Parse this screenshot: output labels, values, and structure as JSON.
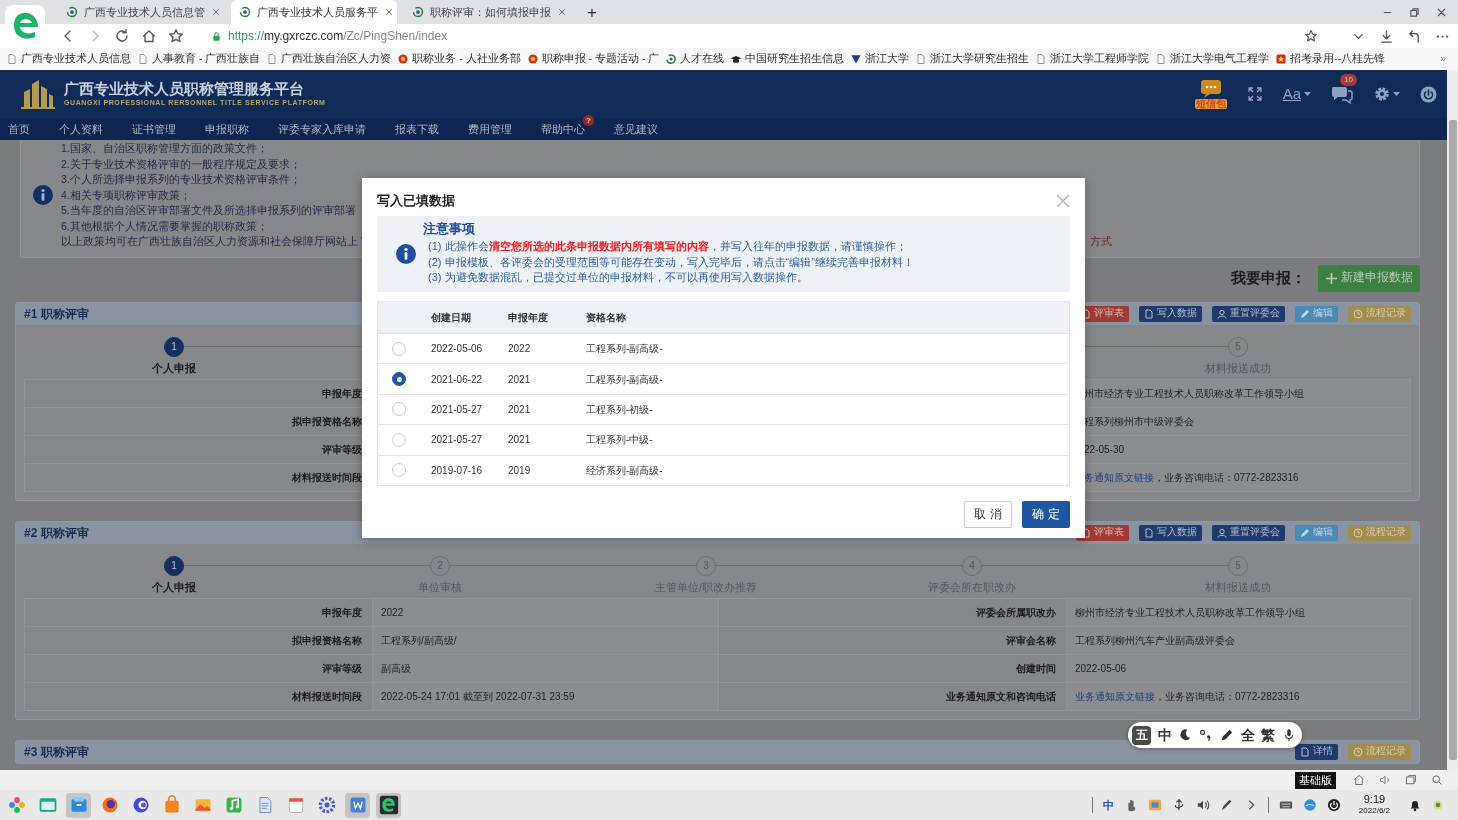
{
  "browser": {
    "tabs": [
      {
        "title": "广西专业技术人员信息管",
        "selected": false
      },
      {
        "title": "广西专业技术人员服务平",
        "selected": true
      },
      {
        "title": "职称评审：如何填报申报",
        "selected": false
      }
    ],
    "new_tab": "+",
    "address": {
      "scheme": "https://",
      "host": "my.gxrczc.com",
      "path": "/Zc/PingShen/index"
    },
    "bookmarks": [
      {
        "kind": "page",
        "label": "广西专业技术人员信息"
      },
      {
        "kind": "page",
        "label": "人事教育 - 广西壮族自"
      },
      {
        "kind": "page",
        "label": "广西壮族自治区人力资"
      },
      {
        "kind": "emblem",
        "label": "职称业务 - 人社业务部"
      },
      {
        "kind": "emblem",
        "label": "职称申报 - 专题活动 - 广"
      },
      {
        "kind": "swirl",
        "label": "人才在线"
      },
      {
        "kind": "cap",
        "label": "中国研究生招生信息"
      },
      {
        "kind": "triangle",
        "label": "浙江大学"
      },
      {
        "kind": "page",
        "label": "浙江大学研究生招生"
      },
      {
        "kind": "page",
        "label": "浙江大学工程师学院"
      },
      {
        "kind": "page",
        "label": "浙江大学电气工程学"
      },
      {
        "kind": "star",
        "label": "招考录用--八桂先锋"
      }
    ],
    "bookmarks_more": "»"
  },
  "site": {
    "title": "广西专业技术人员职称管理服务平台",
    "subtitle": "GUANGXI PROFESSIONAL RERSONNEL TITLE SERVICE PLATFORM",
    "sms_label": "短信包",
    "font_label": "Aa",
    "messages_badge": "10",
    "nav": [
      {
        "label": "首页"
      },
      {
        "label": "个人资料"
      },
      {
        "label": "证书管理"
      },
      {
        "label": "申报职称"
      },
      {
        "label": "评委专家入库申请"
      },
      {
        "label": "报表下载"
      },
      {
        "label": "费用管理"
      },
      {
        "label": "帮助中心",
        "badge": "?"
      },
      {
        "label": "意见建议"
      }
    ]
  },
  "policy": {
    "lines": [
      "1.国家、自治区职称管理方面的政策文件；",
      "2.关于专业技术资格评审的一般程序规定及要求；",
      "3.个人所选择申报系列的专业技术资格评审条件；",
      "4.相关专项职称评审政策；",
      "5.当年度的自治区评审部署文件及所选择申报系列的评审部署",
      "6.其他根据个人情况需要掌握的职称政策；",
      "以上政策均可在广西壮族自治区人力资源和社会保障厅网站上 “"
    ],
    "note": "方式"
  },
  "apply": {
    "label": "我要申报：",
    "button": "新建申报数据"
  },
  "cards": [
    {
      "title": "#1 职称评审",
      "actions": [
        {
          "kind": "review",
          "label": "评审表"
        },
        {
          "kind": "write",
          "label": "写入数据"
        },
        {
          "kind": "reset",
          "label": "重置评委会"
        },
        {
          "kind": "edit",
          "label": "编辑"
        },
        {
          "kind": "log",
          "label": "流程记录"
        }
      ],
      "steps_left": [
        {
          "number": "1",
          "label": "个人申报",
          "selected": true
        }
      ],
      "steps_right": [
        {
          "number": "5",
          "label": "材料报送成功",
          "selected": false
        }
      ],
      "rows": [
        {
          "label": "申报年度",
          "right_value": "州市经济专业工程技术人员职称改革工作领导小组"
        },
        {
          "label": "拟申报资格名称",
          "right_value": "程系列柳州市中级评委会"
        },
        {
          "label": "评审等级",
          "right_value": "22-05-30"
        },
        {
          "label": "材料报送时间段",
          "right_link": "务通知原文链接",
          "right_value": "，业务咨询电话：0772-2823316"
        }
      ]
    },
    {
      "title": "#2 职称评审",
      "actions": [
        {
          "kind": "review",
          "label": "评审表"
        },
        {
          "kind": "write",
          "label": "写入数据"
        },
        {
          "kind": "reset",
          "label": "重置评委会"
        },
        {
          "kind": "edit",
          "label": "编辑"
        },
        {
          "kind": "log",
          "label": "流程记录"
        }
      ],
      "steps": [
        {
          "number": "1",
          "label": "个人申报",
          "selected": true
        },
        {
          "number": "2",
          "label": "单位审核",
          "selected": false
        },
        {
          "number": "3",
          "label": "主管单位/职改办推荐",
          "selected": false
        },
        {
          "number": "4",
          "label": "评委会所在职改办",
          "selected": false
        },
        {
          "number": "5",
          "label": "材料报送成功",
          "selected": false
        }
      ],
      "rows": [
        {
          "label": "申报年度",
          "value": "2022",
          "right_label": "评委会所属职改办",
          "right_value": "柳州市经济专业工程技术人员职称改革工作领导小组"
        },
        {
          "label": "拟申报资格名称",
          "value": "工程系列/副高级/",
          "right_label": "评审会名称",
          "right_value": "工程系列柳州汽车产业副高级评委会"
        },
        {
          "label": "评审等级",
          "value": "副高级",
          "right_label": "创建时间",
          "right_value": "2022-05-06"
        },
        {
          "label": "材料报送时间段",
          "value": "2022-05-24 17:01 截至到 2022-07-31 23:59",
          "right_label": "业务通知原文和咨询电话",
          "right_link": "业务通知原文链接",
          "right_value": "，业务咨询电话：0772-2823316"
        }
      ]
    },
    {
      "title": "#3 职称评审",
      "actions": [
        {
          "kind": "detail",
          "label": "详情"
        },
        {
          "kind": "log",
          "label": "流程记录"
        }
      ]
    }
  ],
  "dialog": {
    "title": "写入已填数据",
    "notice_title": "注意事项",
    "notice_lines": [
      "(1)  此操作会**清空您所选的此条申报数据内所有填写的内容**，并写入往年的申报数据，请谨慎操作；",
      "(2)  申报模板、各评委会的受理范围等可能存在变动，写入完毕后，请点击“编辑”继续完善申报材料！",
      "(3)  为避免数据混乱，已提交过单位的申报材料，不可以再使用写入数据操作。"
    ],
    "columns": [
      "创建日期",
      "申报年度",
      "资格名称"
    ],
    "rows": [
      {
        "date": "2022-05-06",
        "year": "2022",
        "name": "工程系列-副高级-",
        "selected": false
      },
      {
        "date": "2021-06-22",
        "year": "2021",
        "name": "工程系列-副高级-",
        "selected": true
      },
      {
        "date": "2021-05-27",
        "year": "2021",
        "name": "工程系列-初级-",
        "selected": false
      },
      {
        "date": "2021-05-27",
        "year": "2021",
        "name": "工程系列-中级-",
        "selected": false
      },
      {
        "date": "2019-07-16",
        "year": "2019",
        "name": "经济系列-副高级-",
        "selected": false
      }
    ],
    "cancel": "取 消",
    "confirm": "确 定"
  },
  "ime_toolbar": {
    "items": [
      {
        "kind": "logo",
        "text": "五"
      },
      {
        "kind": "text",
        "text": "中"
      },
      {
        "kind": "moon"
      },
      {
        "kind": "punct"
      },
      {
        "kind": "pen"
      },
      {
        "kind": "text",
        "text": "全"
      },
      {
        "kind": "text",
        "text": "繁"
      },
      {
        "kind": "mic"
      }
    ]
  },
  "status_strip": {
    "edition": "基础版"
  },
  "taskbar": {
    "apps": [
      {
        "kind": "launcher",
        "selected": false
      },
      {
        "kind": "window",
        "selected": false
      },
      {
        "kind": "folder",
        "selected": true
      },
      {
        "kind": "globe",
        "selected": false
      },
      {
        "kind": "swirl",
        "selected": false
      },
      {
        "kind": "bag",
        "selected": false
      },
      {
        "kind": "image",
        "selected": false
      },
      {
        "kind": "music",
        "selected": false
      },
      {
        "kind": "document",
        "selected": false
      },
      {
        "kind": "calendar",
        "selected": false
      },
      {
        "kind": "gear",
        "selected": false
      },
      {
        "kind": "writer",
        "selected": true
      },
      {
        "kind": "browser",
        "selected": true
      }
    ],
    "ime": "中",
    "time": "9:19",
    "date": "2022/6/2"
  }
}
